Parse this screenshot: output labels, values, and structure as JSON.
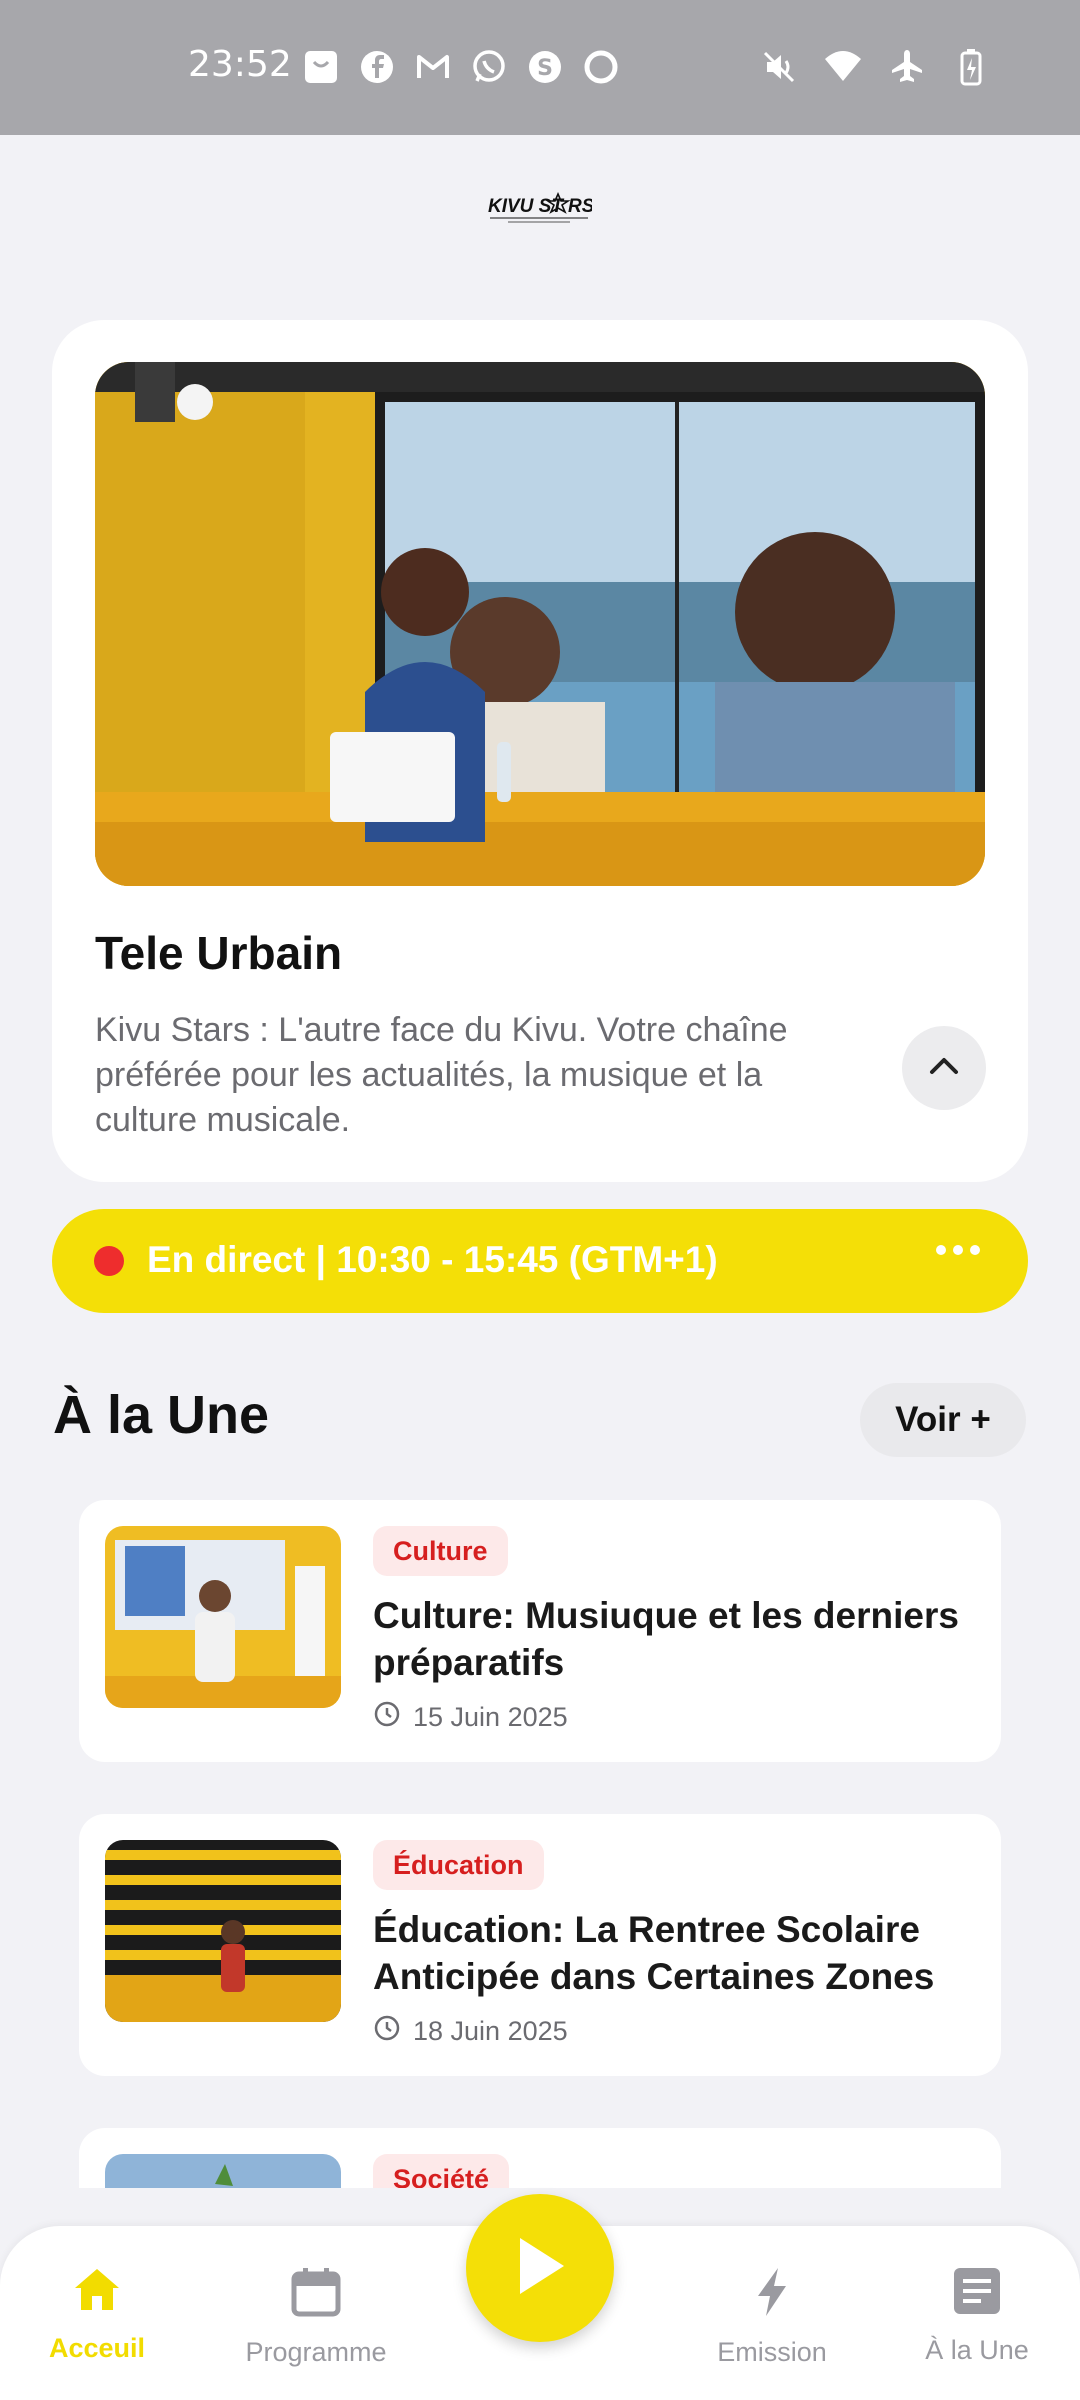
{
  "status_bar": {
    "time": "23:52",
    "left_icons": [
      "shop-icon",
      "facebook-icon",
      "gmail-icon",
      "whatsapp-icon",
      "s-app-icon",
      "circle-app-icon"
    ],
    "right_icons": [
      "mute-icon",
      "wifi-icon",
      "airplane-icon",
      "battery-charging-icon"
    ]
  },
  "logo": {
    "text": "KIVU STARS",
    "tagline": "L'autre face du Kivu"
  },
  "hero": {
    "title": "Tele Urbain",
    "description": "Kivu Stars : L'autre face du Kivu. Votre chaîne préférée pour les actualités, la musique et la culture musicale."
  },
  "live": {
    "label": "En direct | 10:30 - 15:45 (GTM+1)"
  },
  "section": {
    "title": "À la Une",
    "see_more": "Voir +"
  },
  "articles": [
    {
      "category": "Culture",
      "title": "Culture: Musiuque et les derniers préparatifs",
      "date": "15 Juin 2025"
    },
    {
      "category": "Éducation",
      "title": "Éducation: La Rentree Scolaire Anticipée dans Certaines Zones",
      "date": "18 Juin 2025"
    },
    {
      "category": "Société",
      "title": "",
      "date": ""
    }
  ],
  "bottom_nav": {
    "items": [
      {
        "label": "Acceuil",
        "icon": "home-icon",
        "active": true
      },
      {
        "label": "Programme",
        "icon": "calendar-icon",
        "active": false
      },
      {
        "label": "Emission",
        "icon": "lightning-icon",
        "active": false
      },
      {
        "label": "À la Une",
        "icon": "article-icon",
        "active": false
      }
    ],
    "play_icon": "play-icon"
  },
  "colors": {
    "accent": "#f4df07",
    "live_dot": "#ee2d2d",
    "badge_text": "#d61f1f",
    "badge_bg": "#fde9e9"
  }
}
